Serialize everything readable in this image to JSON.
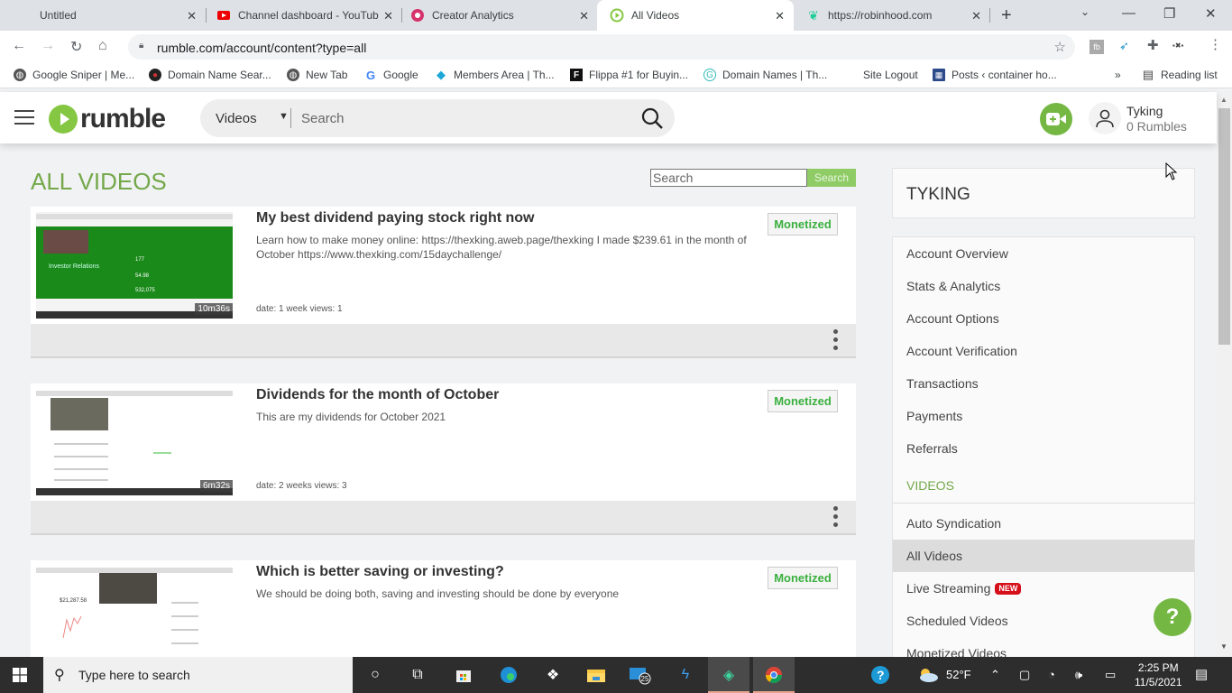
{
  "browser": {
    "tabs": [
      {
        "label": "Untitled",
        "icon": "blank-icon"
      },
      {
        "label": "Channel dashboard - YouTub",
        "icon": "youtube-icon"
      },
      {
        "label": "Creator Analytics",
        "icon": "creator-analytics-icon"
      },
      {
        "label": "All Videos",
        "icon": "rumble-icon",
        "active": true
      },
      {
        "label": "https://robinhood.com",
        "icon": "robinhood-feather-icon"
      }
    ],
    "url": "rumble.com/account/content?type=all",
    "bookmarks": [
      {
        "label": "Google Sniper | Me...",
        "icon": "globe-icon"
      },
      {
        "label": "Domain Name Sear...",
        "icon": "domain-icon"
      },
      {
        "label": "New Tab",
        "icon": "globe-icon"
      },
      {
        "label": "Google",
        "icon": "google-icon"
      },
      {
        "label": "Members Area | Th...",
        "icon": "members-icon"
      },
      {
        "label": "Flippa #1 for Buyin...",
        "icon": "flippa-icon"
      },
      {
        "label": "Domain Names | Th...",
        "icon": "domain-names-icon"
      },
      {
        "label": "Site Logout",
        "icon": ""
      },
      {
        "label": "Posts ‹ container ho...",
        "icon": "grid-icon"
      }
    ],
    "overflow": "»",
    "reading_list": "Reading list"
  },
  "header": {
    "logo": "rumble",
    "search_category": "Videos",
    "search_placeholder": "Search",
    "username": "Tyking",
    "rumbles": "0 Rumbles"
  },
  "main": {
    "title": "ALL VIDEOS",
    "search_placeholder": "Search",
    "search_button": "Search",
    "videos": [
      {
        "title": "My best dividend paying stock right now",
        "description": "Learn how to make money online: https://thexking.aweb.page/thexking I made $239.61 in the month of October https://www.thexking.com/15daychallenge/",
        "meta": "date: 1 week  views: 1",
        "duration": "10m36s",
        "status": "Monetized"
      },
      {
        "title": "Dividends for the month of October",
        "description": "This are my dividends for October 2021",
        "meta": "date: 2 weeks  views: 3",
        "duration": "6m32s",
        "status": "Monetized"
      },
      {
        "title": "Which is better saving or investing?",
        "description": "We should be doing both, saving and investing should be done by everyone",
        "meta": "",
        "duration": "",
        "status": "Monetized"
      }
    ]
  },
  "sidebar": {
    "account_name": "TYKING",
    "items": [
      "Account Overview",
      "Stats & Analytics",
      "Account Options",
      "Account Verification",
      "Transactions",
      "Payments",
      "Referrals"
    ],
    "videos_section": "VIDEOS",
    "video_items": [
      {
        "label": "Auto Syndication"
      },
      {
        "label": "All Videos",
        "active": true
      },
      {
        "label": "Live Streaming",
        "badge": "NEW"
      },
      {
        "label": "Scheduled Videos"
      },
      {
        "label": "Monetized Videos"
      }
    ],
    "help": "?"
  },
  "taskbar": {
    "search_placeholder": "Type here to search",
    "mail_badge": "25",
    "weather": "52°F",
    "time": "2:25 PM",
    "date": "11/5/2021"
  },
  "colors": {
    "accent_green": "#74a84a",
    "monetized_green": "#3ab03e",
    "new_badge_red": "#d5101a"
  }
}
